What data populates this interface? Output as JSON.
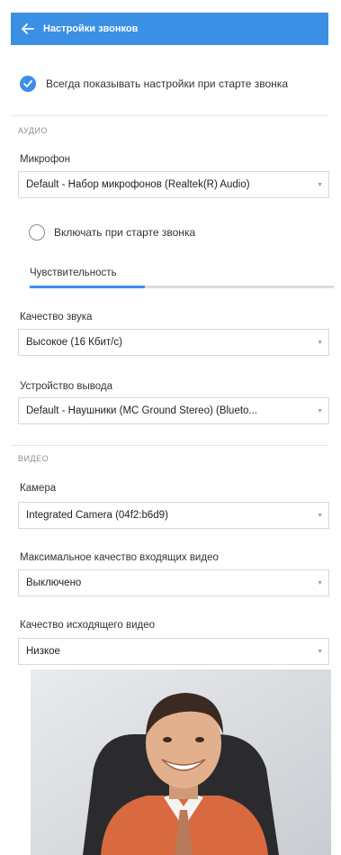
{
  "header": {
    "title": "Настройки звонков",
    "back_icon": "arrow-left-icon"
  },
  "always_show": {
    "label": "Всегда показывать настройки при старте звонка",
    "checked": true
  },
  "audio": {
    "section_title": "АУДИО",
    "microphone": {
      "label": "Микрофон",
      "value": "Default - Набор микрофонов (Realtek(R) Audio)"
    },
    "enable_on_start": {
      "label": "Включать при старте звонка",
      "checked": false
    },
    "sensitivity": {
      "label": "Чувствительность",
      "level": 0.38
    },
    "quality": {
      "label": "Качество звука",
      "value": "Высокое (16 Кбит/с)"
    },
    "output": {
      "label": "Устройство вывода",
      "value": "Default - Наушники (MC Ground Stereo) (Blueto..."
    }
  },
  "video": {
    "section_title": "ВИДЕО",
    "camera": {
      "label": "Камера",
      "value": "Integrated Camera (04f2:b6d9)"
    },
    "incoming_quality": {
      "label": "Максимальное качество входящих видео",
      "value": "Выключено"
    },
    "outgoing_quality": {
      "label": "Качество исходящего видео",
      "value": "Низкое"
    }
  },
  "colors": {
    "accent": "#3b8fe5",
    "divider": "#e6e6e6"
  }
}
